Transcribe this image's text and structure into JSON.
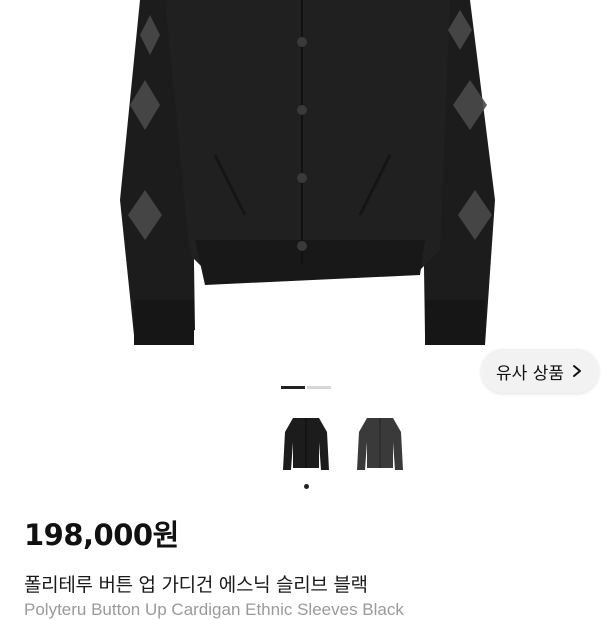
{
  "product": {
    "price": "198,000원",
    "title": "폴리테루 버튼 업 가디건 에스닉 슬리브 블랙",
    "subtitle": "Polyteru Button Up Cardigan Ethnic Sleeves Black"
  },
  "gallery": {
    "similar_button_label": "유사 상품",
    "page_count": 2,
    "active_page": 1,
    "thumbnail_count": 2
  },
  "icons": {
    "similar_chevron": "chevron-right-icon"
  },
  "colors": {
    "garment_main": "#1b1b1b",
    "garment_alt": "#2e2e2e",
    "pattern": "#555555",
    "pager_active": "#222222",
    "pager_inactive": "#d6d6d6"
  }
}
